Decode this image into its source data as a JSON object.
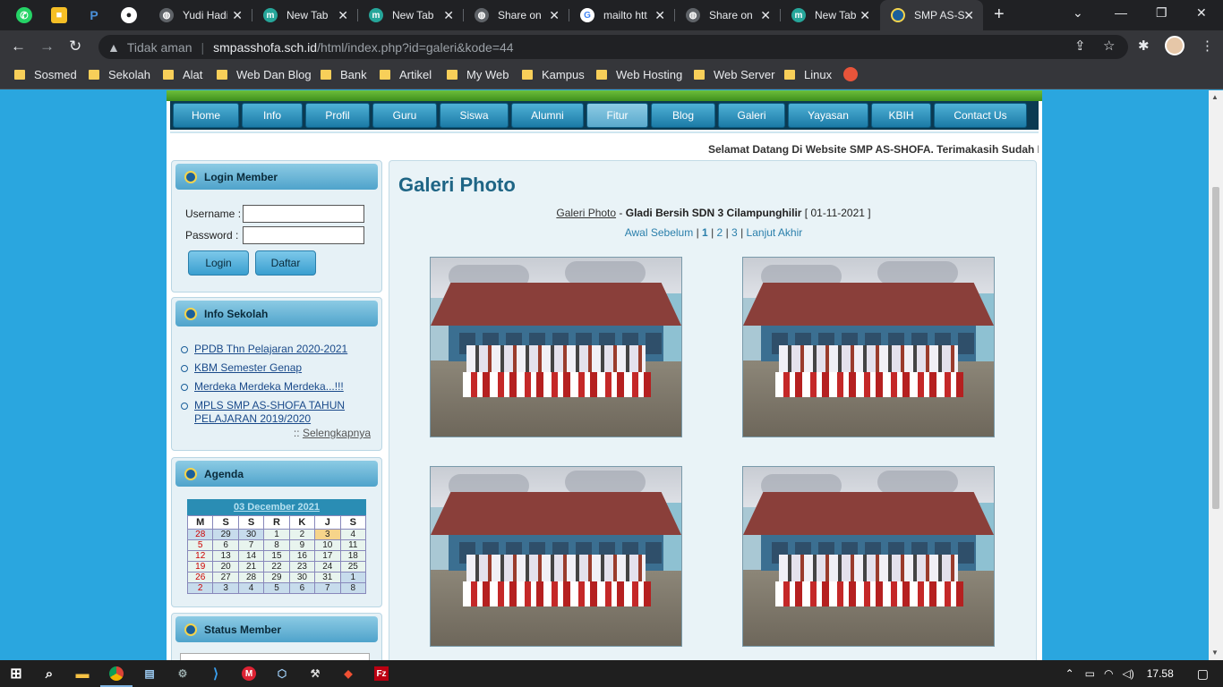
{
  "browser": {
    "pinned_tabs": [
      {
        "icon": "whatsapp-icon",
        "glyph": "W",
        "color": "#25d366"
      },
      {
        "icon": "keep-icon",
        "glyph": "K",
        "color": "#f6bf26"
      },
      {
        "icon": "paypal-icon",
        "glyph": "P",
        "color": "#4a90d9"
      },
      {
        "icon": "github-icon",
        "glyph": "G",
        "color": "#ffffff"
      }
    ],
    "tabs": [
      {
        "title": "Yudi Hadi",
        "icon": "globe-icon"
      },
      {
        "title": "New Tab",
        "icon": "m-icon"
      },
      {
        "title": "New Tab",
        "icon": "m-icon"
      },
      {
        "title": "Share on",
        "icon": "globe-icon"
      },
      {
        "title": "mailto htt",
        "icon": "google-icon"
      },
      {
        "title": "Share on",
        "icon": "globe-icon"
      },
      {
        "title": "New Tab",
        "icon": "m-icon"
      },
      {
        "title": "SMP AS-S",
        "icon": "school-logo-icon",
        "active": true
      }
    ],
    "new_tab": "+",
    "window_controls": {
      "minimize": "—",
      "restore": "❐",
      "close": "✕",
      "dropdown": "⌄"
    },
    "address": {
      "security_label": "Tidak aman",
      "host": "smpasshofa.sch.id",
      "path": "/html/index.php?id=galeri&kode=44"
    },
    "bookmarks": [
      "Sosmed",
      "Sekolah",
      "Alat",
      "Web Dan Blog",
      "Bank",
      "Artikel",
      "My Web",
      "Kampus",
      "Web Hosting",
      "Web Server",
      "Linux"
    ]
  },
  "site": {
    "menu": [
      "Home",
      "Info",
      "Profil",
      "Guru",
      "Siswa",
      "Alumni",
      "Fitur",
      "Blog",
      "Galeri",
      "Yayasan",
      "KBIH",
      "Contact Us"
    ],
    "active_menu": "Fitur",
    "marquee": "Selamat Datang Di Website SMP AS-SHOFA. Terimakasih Sudah M",
    "login": {
      "title": "Login Member",
      "username_label": "Username",
      "password_label": "Password",
      "username_value": "",
      "password_value": "",
      "login_button": "Login",
      "register_button": "Daftar"
    },
    "info": {
      "title": "Info Sekolah",
      "items": [
        "PPDB Thn Pelajaran 2020-2021",
        "KBM Semester Genap",
        "Merdeka Merdeka Merdeka...!!!",
        "MPLS SMP AS-SHOFA TAHUN PELAJARAN 2019/2020"
      ],
      "more_prefix": "::",
      "more_link": "Selengkapnya"
    },
    "agenda": {
      "title": "Agenda",
      "month": "03 December 2021",
      "weekdays": [
        "M",
        "S",
        "S",
        "R",
        "K",
        "J",
        "S"
      ],
      "weeks": [
        [
          "28",
          "29",
          "30",
          "1",
          "2",
          "3",
          "4"
        ],
        [
          "5",
          "6",
          "7",
          "8",
          "9",
          "10",
          "11"
        ],
        [
          "12",
          "13",
          "14",
          "15",
          "16",
          "17",
          "18"
        ],
        [
          "19",
          "20",
          "21",
          "22",
          "23",
          "24",
          "25"
        ],
        [
          "26",
          "27",
          "28",
          "29",
          "30",
          "31",
          "1"
        ],
        [
          "2",
          "3",
          "4",
          "5",
          "6",
          "7",
          "8"
        ]
      ],
      "today": "3"
    },
    "status": {
      "title": "Status Member"
    },
    "gallery": {
      "heading": "Galeri Photo",
      "crumb_link": "Galeri Photo",
      "crumb_sep": "-",
      "album": "Gladi Bersih SDN 3 Cilampunghilir",
      "date": "[ 01-11-2021 ]",
      "pager": {
        "first": "Awal",
        "prev": "Sebelum",
        "pages": [
          "1",
          "2",
          "3"
        ],
        "current": "1",
        "next": "Lanjut",
        "last": "Akhir",
        "sep": "|"
      },
      "photos": 4
    }
  },
  "taskbar": {
    "apps": [
      "windows-start-icon",
      "search-icon",
      "file-explorer-icon",
      "chrome-icon",
      "notepad-icon",
      "settings-icon",
      "vscode-icon",
      "app-m-icon",
      "virtualbox-icon",
      "tools-icon",
      "git-icon",
      "filezilla-icon"
    ],
    "clock": "17.58"
  }
}
